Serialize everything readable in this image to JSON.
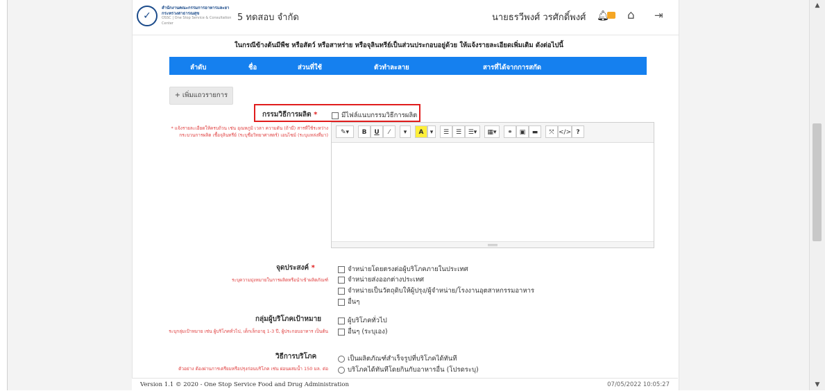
{
  "header": {
    "logo_text": "สำนักงานคณะกรรมการอาหารและยา",
    "logo_text2": "กระทรวงสาธารณสุข",
    "logo_text3": "OSSC | One Stop Service & Consultation Center",
    "company": "5 ทดสอบ จำกัด",
    "user": "นายธรวีพงศ์ วรศักดิ์พงศ์"
  },
  "notice": "ในกรณีข้างต้นมีพืช หรือสัตว์ หรือสาหร่าย หรือจุลินทรีย์เป็นส่วนประกอบอยู่ด้วย ให้แจ้งรายละเอียดเพิ่มเติม ดังต่อไปนี้",
  "table": {
    "headers": [
      "ลำดับ",
      "ชื่อ",
      "ส่วนที่ใช้",
      "ตัวทำละลาย",
      "สารที่ได้จากการสกัด"
    ]
  },
  "add_row_label": "+ เพิ่มแถวรายการ",
  "production": {
    "label": "กรรมวิธีการผลิต",
    "required": "*",
    "attach_label": "มีไฟล์แนบกรรมวิธีการผลิต",
    "hint": "* แจ้งรายละเอียดให้ครบถ้วน เช่น อุณหภูมิ เวลา ความดัน (ถ้ามี) สารที่ใช้ระหว่างกระบวนการผลิต เชื้อจุลินทรีย์ (ระบุชื่อวิทยาศาสตร์) เอนไซม์ (ระบุแหล่งที่มา)"
  },
  "editor_toolbar": [
    "✎▾",
    "B",
    "U",
    "⁄",
    "▾",
    "A",
    "▾",
    "☰",
    "☰",
    "☰▾",
    "▦▾",
    "⚭",
    "▣",
    "▬",
    "⤧",
    "</>",
    "?"
  ],
  "purpose": {
    "label": "จุดประสงค์",
    "required": "*",
    "hint": "ระบุความมุ่งหมายในการผลิตหรือนำเข้าผลิตภัณฑ์",
    "options": [
      "จำหน่ายโดยตรงต่อผู้บริโภคภายในประเทศ",
      "จำหน่ายส่งออกต่างประเทศ",
      "จำหน่ายเป็นวัตถุดิบให้ผู้ปรุง/ผู้จำหน่าย/โรงงานอุตสาหกรรมอาหาร",
      "อื่นๆ"
    ]
  },
  "target": {
    "label": "กลุ่มผู้บริโภคเป้าหมาย",
    "hint": "ระบุกลุ่มเป้าหมาย เช่น ผู้บริโภคทั่วไป, เด็กเล็กอายุ 1-3 ปี, ผู้ประกอบอาหาร เป็นต้น",
    "options": [
      "ผู้บริโภคทั่วไป",
      "อื่นๆ (ระบุเอง)"
    ]
  },
  "consume": {
    "label": "วิธีการบริโภค",
    "hint": "ตัวอย่าง ต้องผ่านการเตรียมหรือปรุงก่อนบริโภค เช่น ผ่อนผสมน้ำ 150 มล. ต่อ",
    "options": [
      "เป็นผลิตภัณฑ์สำเร็จรูปที่บริโภคได้ทันที",
      "บริโภคได้ทันทีโดยกินกับอาหารอื่น (โปรดระบุ)"
    ]
  },
  "footer": {
    "version": "Version 1.1 © 2020 - One Stop Service Food and Drug Administration",
    "timestamp": "07/05/2022 10:05:27"
  }
}
